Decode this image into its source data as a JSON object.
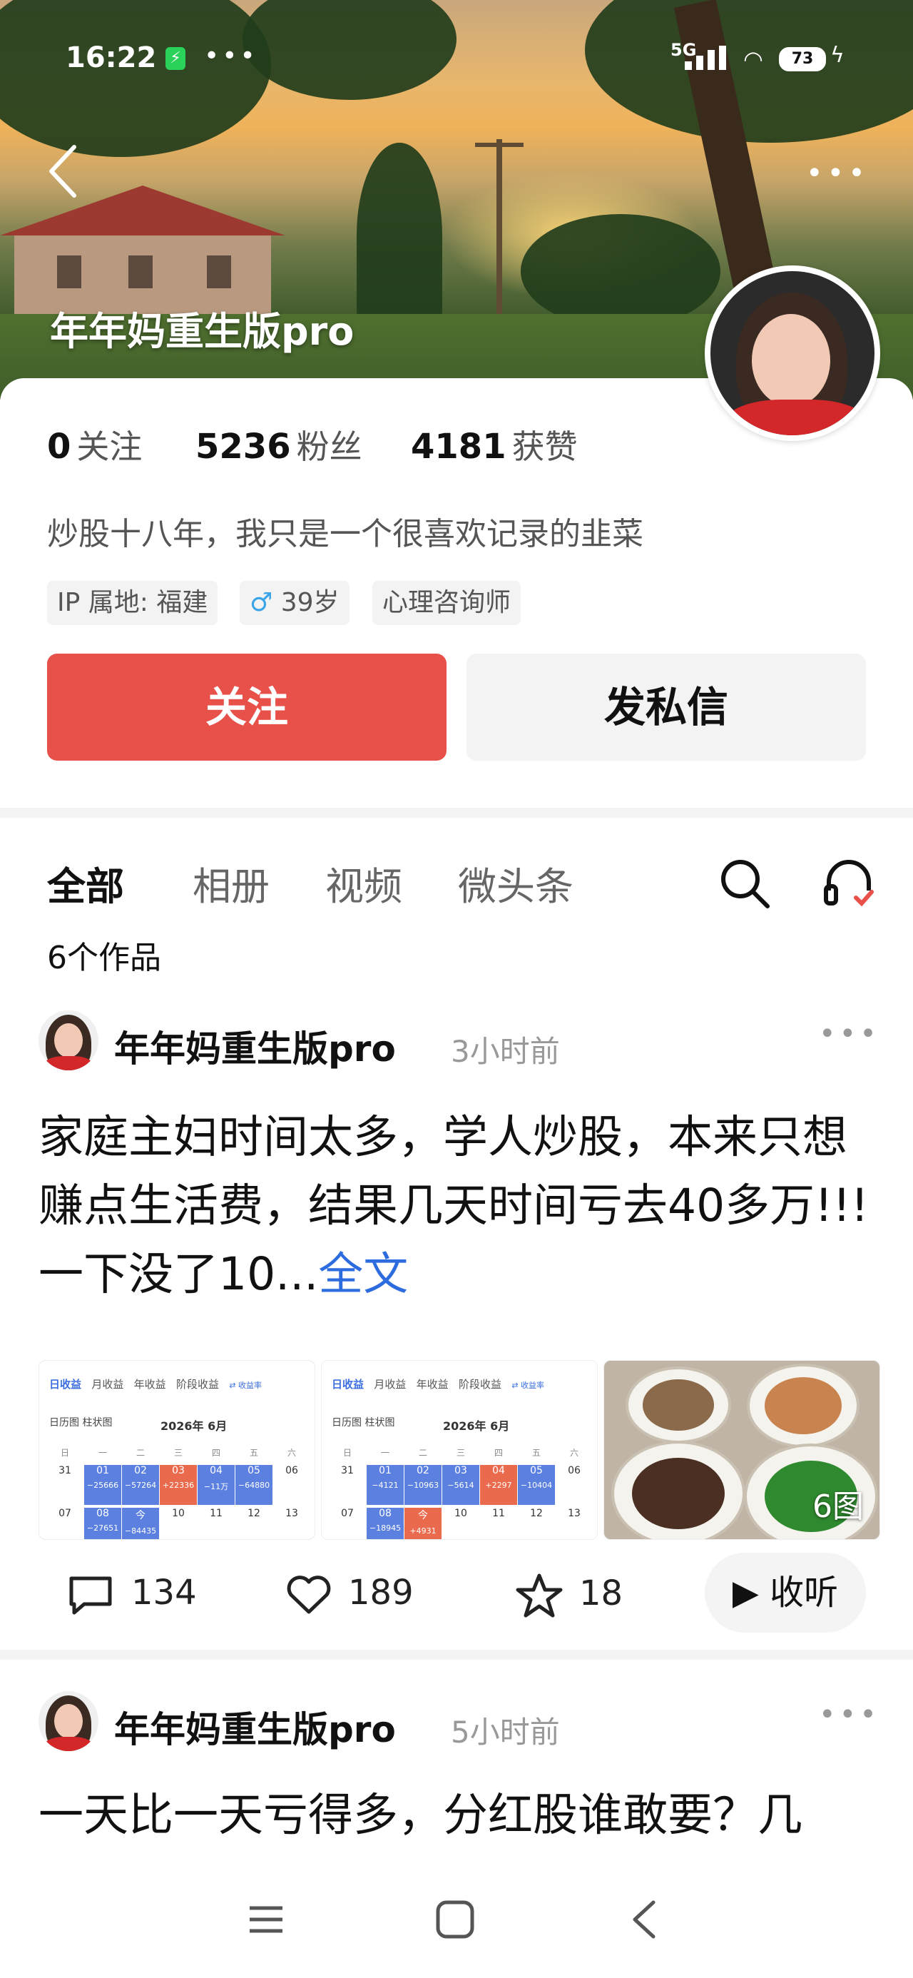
{
  "status_bar": {
    "time": "16:22",
    "network": "5G",
    "battery": "73"
  },
  "profile": {
    "name": "年年妈重生版pro",
    "stats": [
      {
        "num": "0",
        "label": "关注"
      },
      {
        "num": "5236",
        "label": "粉丝"
      },
      {
        "num": "4181",
        "label": "获赞"
      }
    ],
    "bio": "炒股十八年，我只是一个很喜欢记录的韭菜",
    "tags": {
      "ip": "IP 属地: 福建",
      "age": "39岁",
      "job": "心理咨询师"
    },
    "follow_label": "关注",
    "message_label": "发私信"
  },
  "tabs": [
    "全部",
    "相册",
    "视频",
    "微头条"
  ],
  "works_count": "6个作品",
  "posts": [
    {
      "author": "年年妈重生版pro",
      "time": "3小时前",
      "text": "家庭主妇时间太多，学人炒股，本来只想赚点生活费，结果几天时间亏去40多万!!! 一下没了10...",
      "more_link": "全文",
      "image_count": "6图",
      "comments": "134",
      "likes": "189",
      "stars": "18",
      "listen_label": "收听"
    },
    {
      "author": "年年妈重生版pro",
      "time": "5小时前",
      "text": "一天比一天亏得多，分红股谁敢要？几"
    }
  ],
  "calendar_1": {
    "tabs": [
      "日收益",
      "月收益",
      "年收益",
      "阶段收益",
      "⇄ 收益率"
    ],
    "views": "日历图  柱状图",
    "month": "2026年 6月",
    "weekdays": [
      "日",
      "一",
      "二",
      "三",
      "四",
      "五",
      "六"
    ],
    "row1": [
      {
        "d": "31"
      },
      {
        "d": "01",
        "v": "−25666"
      },
      {
        "d": "02",
        "v": "−57264"
      },
      {
        "d": "03",
        "v": "+22336"
      },
      {
        "d": "04",
        "v": "−11万"
      },
      {
        "d": "05",
        "v": "−64880"
      },
      {
        "d": "06"
      }
    ],
    "row2": [
      {
        "d": "07"
      },
      {
        "d": "08",
        "v": "−27651"
      },
      {
        "d": "今",
        "v": "−84435"
      },
      {
        "d": "10"
      },
      {
        "d": "11"
      },
      {
        "d": "12"
      },
      {
        "d": "13"
      }
    ]
  },
  "calendar_2": {
    "tabs": [
      "日收益",
      "月收益",
      "年收益",
      "阶段收益",
      "⇄ 收益率"
    ],
    "views": "日历图  柱状图",
    "month": "2026年 6月",
    "weekdays": [
      "日",
      "一",
      "二",
      "三",
      "四",
      "五",
      "六"
    ],
    "row1": [
      {
        "d": "31"
      },
      {
        "d": "01",
        "v": "−4121"
      },
      {
        "d": "02",
        "v": "−10963"
      },
      {
        "d": "03",
        "v": "−5614"
      },
      {
        "d": "04",
        "v": "+2297"
      },
      {
        "d": "05",
        "v": "−10404"
      },
      {
        "d": "06"
      }
    ],
    "row2": [
      {
        "d": "07"
      },
      {
        "d": "08",
        "v": "−18945"
      },
      {
        "d": "今",
        "v": "+4931"
      },
      {
        "d": "10"
      },
      {
        "d": "11"
      },
      {
        "d": "12"
      },
      {
        "d": "13"
      }
    ]
  },
  "colors": {
    "accent": "#e8514a",
    "link": "#2d6cdf",
    "loss": "#5b80e0",
    "gain": "#ea6a4d"
  }
}
